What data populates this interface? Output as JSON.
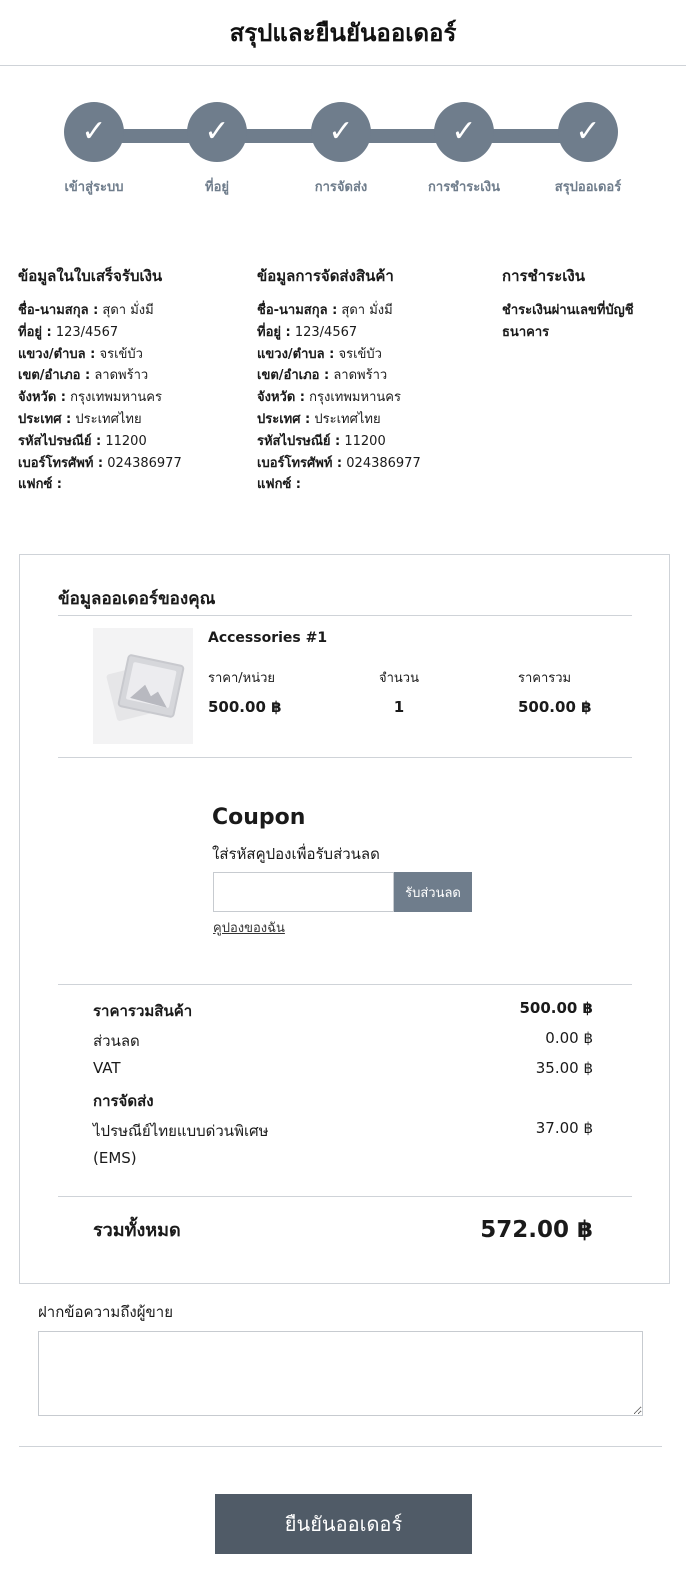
{
  "header": {
    "title": "สรุปและยืนยันออเดอร์"
  },
  "stepper": {
    "check_glyph": "✓",
    "steps": [
      {
        "label": "เข้าสู่ระบบ"
      },
      {
        "label": "ที่อยู่"
      },
      {
        "label": "การจัดส่ง"
      },
      {
        "label": "การชำระเงิน"
      },
      {
        "label": "สรุปออเดอร์"
      }
    ]
  },
  "billing": {
    "title": "ข้อมูลในใบเสร็จรับเงิน",
    "rows": [
      {
        "label": "ชื่อ-นามสกุล :",
        "value": " สุดา มั่งมี"
      },
      {
        "label": "ที่อยู่ :",
        "value": " 123/4567"
      },
      {
        "label": "แขวง/ตำบล :",
        "value": " จรเข้บัว"
      },
      {
        "label": "เขต/อำเภอ :",
        "value": " ลาดพร้าว"
      },
      {
        "label": "จังหวัด :",
        "value": " กรุงเทพมหานคร"
      },
      {
        "label": "ประเทศ :",
        "value": " ประเทศไทย"
      },
      {
        "label": "รหัสไปรษณีย์ :",
        "value": " 11200"
      },
      {
        "label": "เบอร์โทรศัพท์ :",
        "value": " 024386977"
      },
      {
        "label": "แฟกซ์ :",
        "value": ""
      }
    ]
  },
  "shipping": {
    "title": "ข้อมูลการจัดส่งสินค้า",
    "rows": [
      {
        "label": "ชื่อ-นามสกุล :",
        "value": " สุดา มั่งมี"
      },
      {
        "label": "ที่อยู่ :",
        "value": " 123/4567"
      },
      {
        "label": "แขวง/ตำบล :",
        "value": " จรเข้บัว"
      },
      {
        "label": "เขต/อำเภอ :",
        "value": " ลาดพร้าว"
      },
      {
        "label": "จังหวัด :",
        "value": " กรุงเทพมหานคร"
      },
      {
        "label": "ประเทศ :",
        "value": " ประเทศไทย"
      },
      {
        "label": "รหัสไปรษณีย์ :",
        "value": " 11200"
      },
      {
        "label": "เบอร์โทรศัพท์ :",
        "value": " 024386977"
      },
      {
        "label": "แฟกซ์ :",
        "value": ""
      }
    ]
  },
  "payment": {
    "title": "การชำระเงิน",
    "method_line1": "ชำระเงินผ่านเลขที่บัญชี",
    "method_line2": "ธนาคาร"
  },
  "order": {
    "title": "ข้อมูลออเดอร์ของคุณ",
    "product": {
      "name": "Accessories #1",
      "unit_price_label": "ราคา/หน่วย",
      "unit_price": "500.00 ฿",
      "qty_label": "จำนวน",
      "qty": "1",
      "total_label": "ราคารวม",
      "total": "500.00 ฿"
    },
    "coupon": {
      "title": "Coupon",
      "description": "ใส่รหัสคูปองเพื่อรับส่วนลด",
      "input_value": "",
      "apply_label": "รับส่วนลด",
      "my_coupons_link": "คูปองของฉัน"
    },
    "summary": {
      "subtotal_label": "ราคารวมสินค้า",
      "subtotal": "500.00 ฿",
      "discount_label": "ส่วนลด",
      "discount": "0.00 ฿",
      "vat_label": "VAT",
      "vat": "35.00 ฿",
      "shipping_heading": "การจัดส่ง",
      "shipping_method_line1": "ไปรษณีย์ไทยแบบด่วนพิเศษ",
      "shipping_method_line2": "(EMS)",
      "shipping_cost": "37.00 ฿",
      "grand_total_label": "รวมทั้งหมด",
      "grand_total": "572.00 ฿"
    }
  },
  "note": {
    "label": "ฝากข้อความถึงผู้ขาย",
    "value": ""
  },
  "confirm": {
    "label": "ยืนยันออเดอร์"
  },
  "colors": {
    "accent": "#6f7d8c",
    "button_dark": "#505b67",
    "border": "#cfd3d8"
  }
}
